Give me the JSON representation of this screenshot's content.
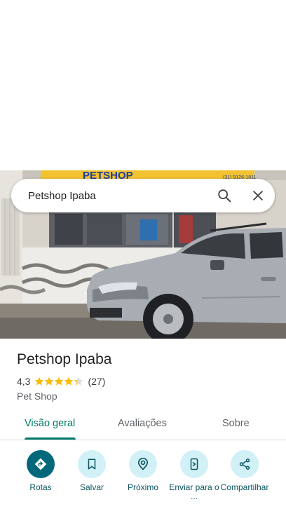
{
  "search": {
    "query": "Petshop Ipaba"
  },
  "photo": {
    "sign_text": "PETSHOP",
    "phone_text": "(31) 9126-1811"
  },
  "place": {
    "title": "Petshop Ipaba",
    "rating": "4,3",
    "stars": 4.3,
    "review_count": "(27)",
    "category": "Pet Shop"
  },
  "tabs": [
    {
      "label": "Visão geral",
      "active": true
    },
    {
      "label": "Avaliações",
      "active": false
    },
    {
      "label": "Sobre",
      "active": false
    }
  ],
  "actions": [
    {
      "label": "Rotas",
      "icon": "directions-icon"
    },
    {
      "label": "Salvar",
      "icon": "bookmark-icon"
    },
    {
      "label": "Próximo",
      "icon": "nearby-icon"
    },
    {
      "label": "Enviar para o ...",
      "icon": "send-to-phone-icon"
    },
    {
      "label": "Compartilhar",
      "icon": "share-icon"
    }
  ],
  "colors": {
    "accent": "#00796b",
    "action_bg": "#d2f1f7",
    "primary_action": "#00687a",
    "star": "#fbbc04"
  }
}
